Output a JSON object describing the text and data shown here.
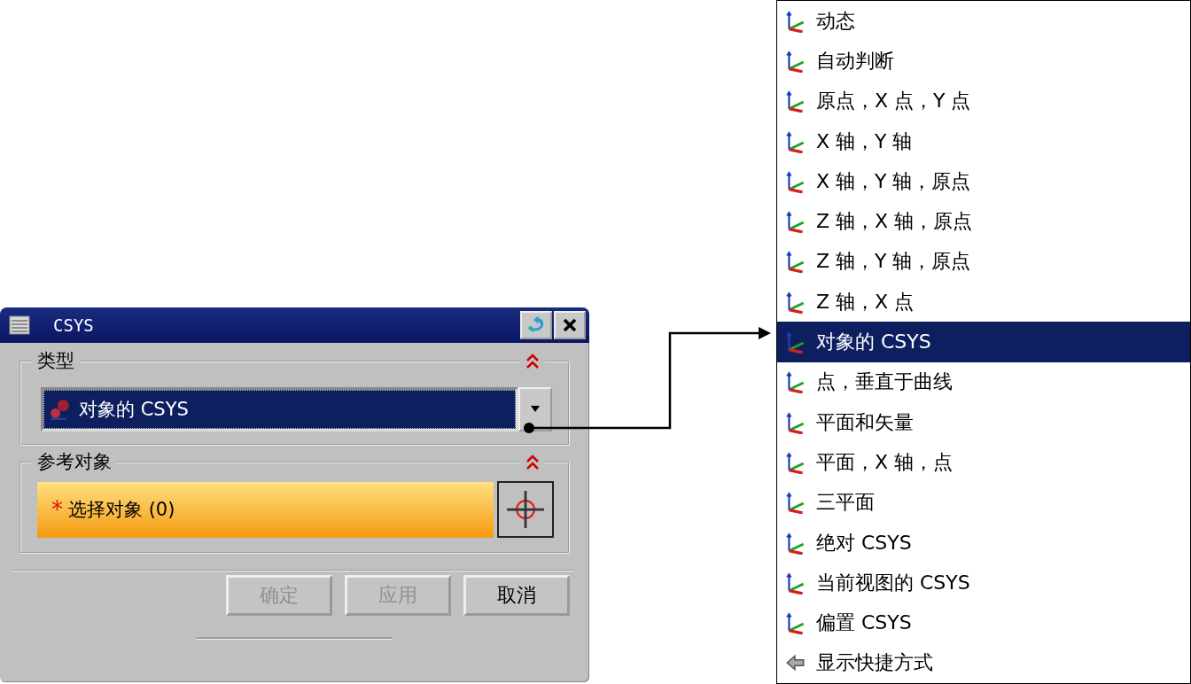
{
  "dialog": {
    "title": "CSYS",
    "type_section": {
      "title": "类型",
      "expanded": true,
      "value": "对象的 CSYS"
    },
    "reference_section": {
      "title": "参考对象",
      "expanded": true,
      "marker": "*",
      "prompt": "选择对象 (0)"
    },
    "buttons": [
      {
        "label": "确定",
        "disabled": true
      },
      {
        "label": "应用",
        "disabled": true
      },
      {
        "label": "取消",
        "disabled": false
      }
    ]
  },
  "menu": {
    "items": [
      {
        "label": "动态",
        "kind": "axes",
        "selected": false
      },
      {
        "label": "自动判断",
        "kind": "axes",
        "selected": false
      },
      {
        "label": "原点，X 点，Y 点",
        "kind": "axes",
        "selected": false
      },
      {
        "label": "X 轴，Y 轴",
        "kind": "axes",
        "selected": false
      },
      {
        "label": "X 轴，Y 轴，原点",
        "kind": "axes",
        "selected": false
      },
      {
        "label": "Z 轴，X 轴，原点",
        "kind": "axes",
        "selected": false
      },
      {
        "label": "Z 轴，Y 轴，原点",
        "kind": "axes",
        "selected": false
      },
      {
        "label": "Z 轴，X 点",
        "kind": "axes",
        "selected": false
      },
      {
        "label": "对象的 CSYS",
        "kind": "axes",
        "selected": true
      },
      {
        "label": "点，垂直于曲线",
        "kind": "axes",
        "selected": false
      },
      {
        "label": "平面和矢量",
        "kind": "axes",
        "selected": false
      },
      {
        "label": "平面，X 轴，点",
        "kind": "axes",
        "selected": false
      },
      {
        "label": "三平面",
        "kind": "axes",
        "selected": false
      },
      {
        "label": "绝对 CSYS",
        "kind": "axes",
        "selected": false
      },
      {
        "label": "当前视图的 CSYS",
        "kind": "axes",
        "selected": false
      },
      {
        "label": "偏置 CSYS",
        "kind": "axes",
        "selected": false
      },
      {
        "label": "显示快捷方式",
        "kind": "shortcut",
        "selected": false
      }
    ]
  }
}
